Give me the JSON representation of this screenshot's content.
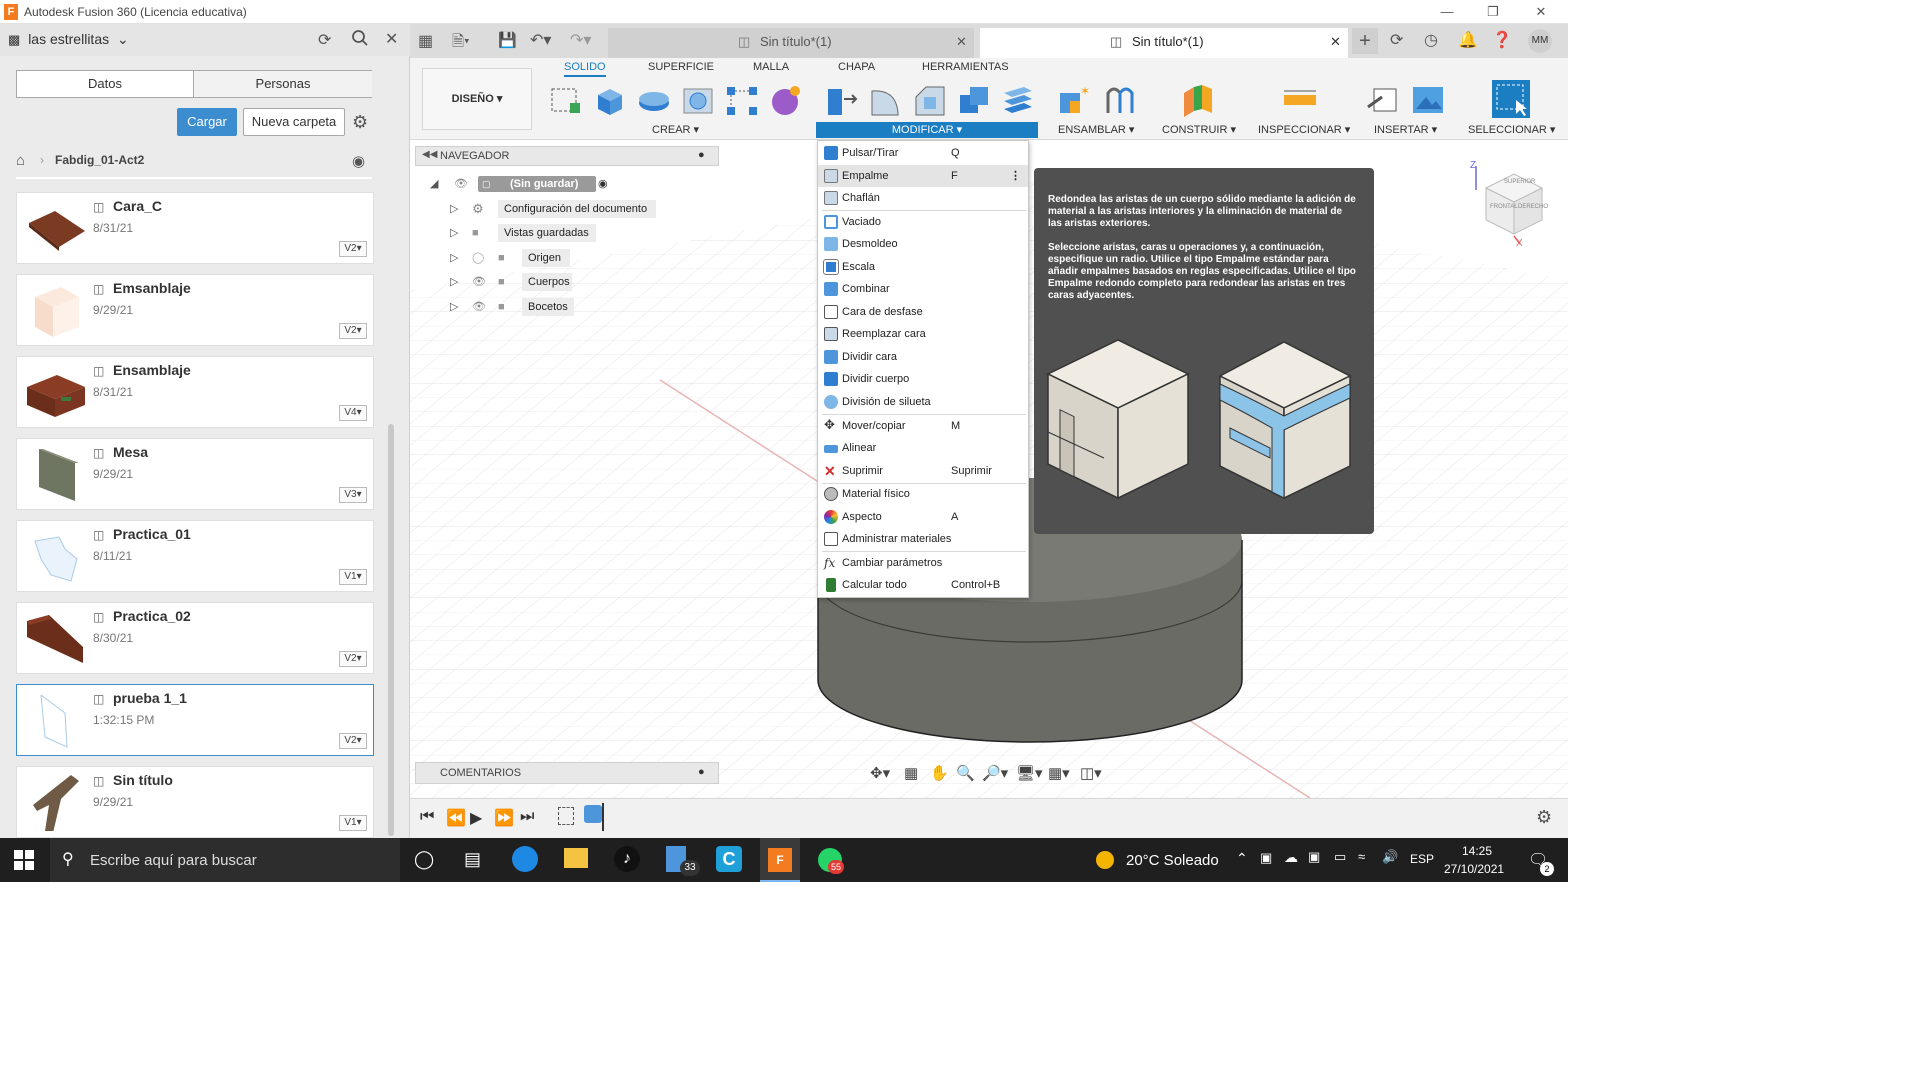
{
  "titlebar": {
    "app_title": "Autodesk Fusion 360 (Licencia educativa)",
    "logo": "F"
  },
  "left_panel": {
    "team_name": "las estrellitas",
    "tabs": [
      "Datos",
      "Personas"
    ],
    "upload_label": "Cargar",
    "new_folder_label": "Nueva carpeta",
    "breadcrumb": "Fabdig_01-Act2",
    "files": [
      {
        "name": "Cara_C",
        "date": "8/31/21",
        "version": "V2▾"
      },
      {
        "name": "Emsanblaje",
        "date": "9/29/21",
        "version": "V2▾"
      },
      {
        "name": "Ensamblaje",
        "date": "8/31/21",
        "version": "V4▾"
      },
      {
        "name": "Mesa",
        "date": "9/29/21",
        "version": "V3▾"
      },
      {
        "name": "Practica_01",
        "date": "8/11/21",
        "version": "V1▾"
      },
      {
        "name": "Practica_02",
        "date": "8/30/21",
        "version": "V2▾"
      },
      {
        "name": "prueba 1_1",
        "date": "1:32:15 PM",
        "version": "V2▾"
      },
      {
        "name": "Sin título",
        "date": "9/29/21",
        "version": "V1▾"
      }
    ]
  },
  "doc_tabs": [
    {
      "label": "Sin título*(1)"
    },
    {
      "label": "Sin título*(1)"
    }
  ],
  "user_initials": "MM",
  "toolbar": {
    "design_label": "DISEÑO ▾",
    "workspace_tabs": [
      "SOLIDO",
      "SUPERFICIE",
      "MALLA",
      "CHAPA",
      "HERRAMIENTAS"
    ],
    "groups": {
      "create": "CREAR ▾",
      "modify": "MODIFICAR ▾",
      "assemble": "ENSAMBLAR ▾",
      "construct": "CONSTRUIR ▾",
      "inspect": "INSPECCIONAR ▾",
      "insert": "INSERTAR ▾",
      "select": "SELECCIONAR ▾"
    }
  },
  "browser": {
    "title": "NAVEGADOR",
    "root": "(Sin guardar)",
    "items": [
      "Configuración del documento",
      "Vistas guardadas",
      "Origen",
      "Cuerpos",
      "Bocetos"
    ]
  },
  "modify_menu": {
    "items": [
      {
        "label": "Pulsar/Tirar",
        "shortcut": "Q"
      },
      {
        "label": "Empalme",
        "shortcut": "F"
      },
      {
        "label": "Chaflán",
        "shortcut": ""
      },
      {
        "label": "Vaciado",
        "shortcut": ""
      },
      {
        "label": "Desmoldeo",
        "shortcut": ""
      },
      {
        "label": "Escala",
        "shortcut": ""
      },
      {
        "label": "Combinar",
        "shortcut": ""
      },
      {
        "label": "Cara de desfase",
        "shortcut": ""
      },
      {
        "label": "Reemplazar cara",
        "shortcut": ""
      },
      {
        "label": "Dividir cara",
        "shortcut": ""
      },
      {
        "label": "Dividir cuerpo",
        "shortcut": ""
      },
      {
        "label": "División de silueta",
        "shortcut": ""
      },
      {
        "label": "Mover/copiar",
        "shortcut": "M"
      },
      {
        "label": "Alinear",
        "shortcut": ""
      },
      {
        "label": "Suprimir",
        "shortcut": "Suprimir"
      },
      {
        "label": "Material físico",
        "shortcut": ""
      },
      {
        "label": "Aspecto",
        "shortcut": "A"
      },
      {
        "label": "Administrar materiales",
        "shortcut": ""
      },
      {
        "label": "Cambiar parámetros",
        "shortcut": ""
      },
      {
        "label": "Calcular todo",
        "shortcut": "Control+B"
      }
    ]
  },
  "tooltip": {
    "para1": "Redondea las aristas de un cuerpo sólido mediante la adición de material a las aristas interiores y la eliminación de material de las aristas exteriores.",
    "para2": "Seleccione aristas, caras u operaciones y, a continuación, especifique un radio. Utilice el tipo Empalme estándar para añadir empalmes basados en reglas especificadas. Utilice el tipo Empalme redondo completo para redondear las aristas en tres caras adyacentes."
  },
  "comments_label": "COMENTARIOS",
  "viewcube": {
    "top": "SUPERIOR",
    "front": "FRONTAL",
    "right": "DERECHO",
    "axis_z": "Z",
    "axis_x": "X"
  },
  "taskbar": {
    "search_placeholder": "Escribe aquí para buscar",
    "weather": "20°C  Soleado",
    "language": "ESP",
    "time": "14:25",
    "date": "27/10/2021",
    "badge_files": "33",
    "badge_whatsapp": "55",
    "notif_count": "2"
  }
}
